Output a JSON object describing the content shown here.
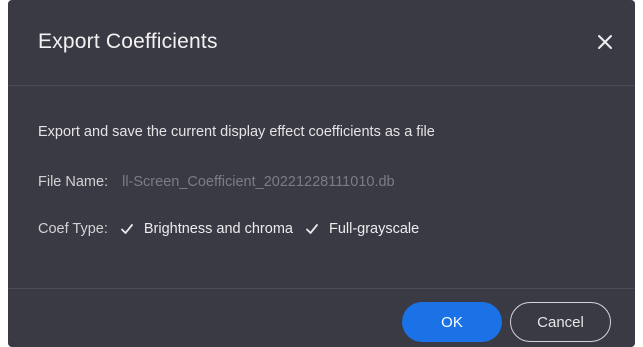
{
  "dialog": {
    "title": "Export Coefficients",
    "close_icon": "close-icon"
  },
  "body": {
    "description": "Export and save the current display effect coefficients as a file",
    "file_name_label": "File Name:",
    "file_name_value": "ll-Screen_Coefficient_20221228111010.db",
    "coef_type_label": "Coef Type:",
    "options": [
      {
        "label": "Brightness and chroma",
        "checked": true,
        "icon": "checkmark-icon"
      },
      {
        "label": "Full-grayscale",
        "checked": true,
        "icon": "checkmark-icon"
      }
    ]
  },
  "footer": {
    "ok_label": "OK",
    "cancel_label": "Cancel"
  },
  "colors": {
    "dialog_bg": "#3a3a45",
    "accent": "#1a72e6",
    "muted_text": "#7c7c86"
  }
}
